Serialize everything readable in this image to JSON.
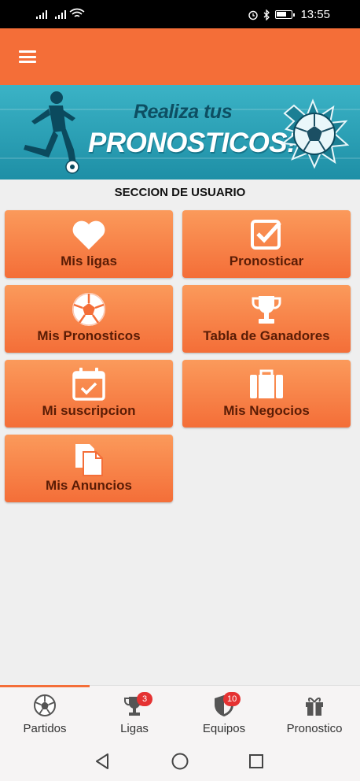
{
  "status_bar": {
    "time": "13:55",
    "icons": [
      "signal-icon",
      "signal-icon",
      "wifi-icon",
      "alarm-icon",
      "bluetooth-icon",
      "battery-icon"
    ]
  },
  "app_bar": {
    "menu_icon": "hamburger-menu-icon"
  },
  "banner": {
    "line1": "Realiza tus",
    "line2": "PRONOSTICOS!!!",
    "colors": {
      "background": "#2aa3b8",
      "line1": "#0d4f63",
      "line2": "#ffffff"
    }
  },
  "section": {
    "title": "SECCION DE USUARIO"
  },
  "tiles": [
    {
      "label": "Mis ligas",
      "icon": "heart-icon"
    },
    {
      "label": "Pronosticar",
      "icon": "checkbox-icon"
    },
    {
      "label": "Mis Pronosticos",
      "icon": "soccer-ball-icon"
    },
    {
      "label": "Tabla de Ganadores",
      "icon": "trophy-icon"
    },
    {
      "label": "Mi suscripcion",
      "icon": "calendar-check-icon"
    },
    {
      "label": "Mis Negocios",
      "icon": "suitcase-icon"
    },
    {
      "label": "Mis Anuncios",
      "icon": "documents-icon"
    }
  ],
  "bottom_nav": {
    "items": [
      {
        "label": "Partidos",
        "icon": "soccer-ball-icon",
        "badge": null,
        "active": true
      },
      {
        "label": "Ligas",
        "icon": "trophy-icon",
        "badge": "3",
        "active": false
      },
      {
        "label": "Equipos",
        "icon": "shield-icon",
        "badge": "10",
        "active": false
      },
      {
        "label": "Pronostico",
        "icon": "gift-icon",
        "badge": null,
        "active": false
      }
    ]
  },
  "system_nav": {
    "icons": [
      "back-icon",
      "home-icon",
      "recents-icon"
    ]
  },
  "colors": {
    "accent": "#f46e38",
    "tile_text": "#5a1c05",
    "badge": "#e53232"
  }
}
